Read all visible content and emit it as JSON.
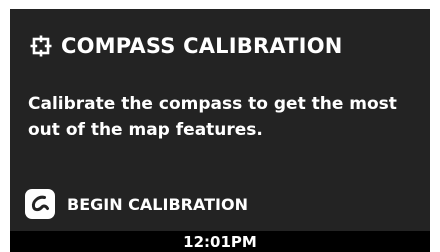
{
  "header": {
    "title": "COMPASS CALIBRATION",
    "icon": "crosshair-square-icon"
  },
  "message": "Calibrate the compass to get the most out of the map features.",
  "action": {
    "label": "BEGIN CALIBRATION",
    "icon": "swipe-gesture-icon"
  },
  "status_bar": {
    "time": "12:01PM"
  },
  "colors": {
    "screen_background": "#232323",
    "status_bar_background": "#000000",
    "text": "#ffffff",
    "badge": "#ffffff"
  }
}
